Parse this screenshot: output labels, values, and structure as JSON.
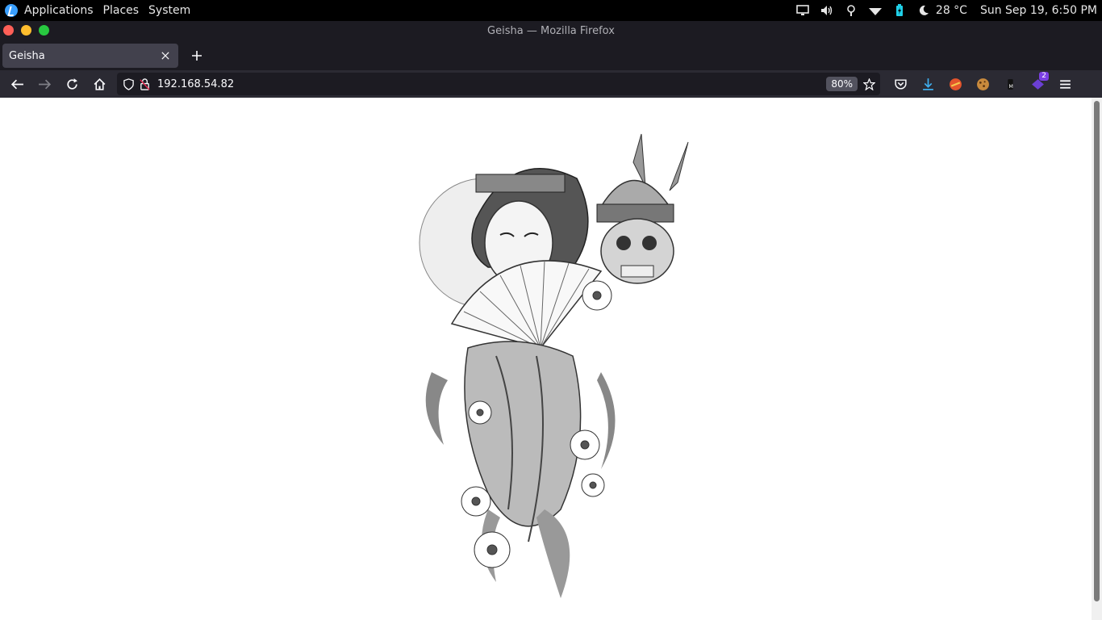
{
  "panel": {
    "menus": [
      "Applications",
      "Places",
      "System"
    ],
    "temperature": "28 °C",
    "clock": "Sun Sep 19,  6:50 PM"
  },
  "window": {
    "title": "Geisha — Mozilla Firefox"
  },
  "tabs": [
    {
      "label": "Geisha"
    }
  ],
  "navbar": {
    "url": "192.168.54.82",
    "zoom": "80%",
    "extension_badge": "2"
  },
  "colors": {
    "close": "#ff5f57",
    "minimize": "#ffbd2e",
    "maximize": "#28c840",
    "download_accent": "#3fb0f0"
  },
  "content": {
    "image_description_icon": "geisha-samurai-illustration"
  }
}
